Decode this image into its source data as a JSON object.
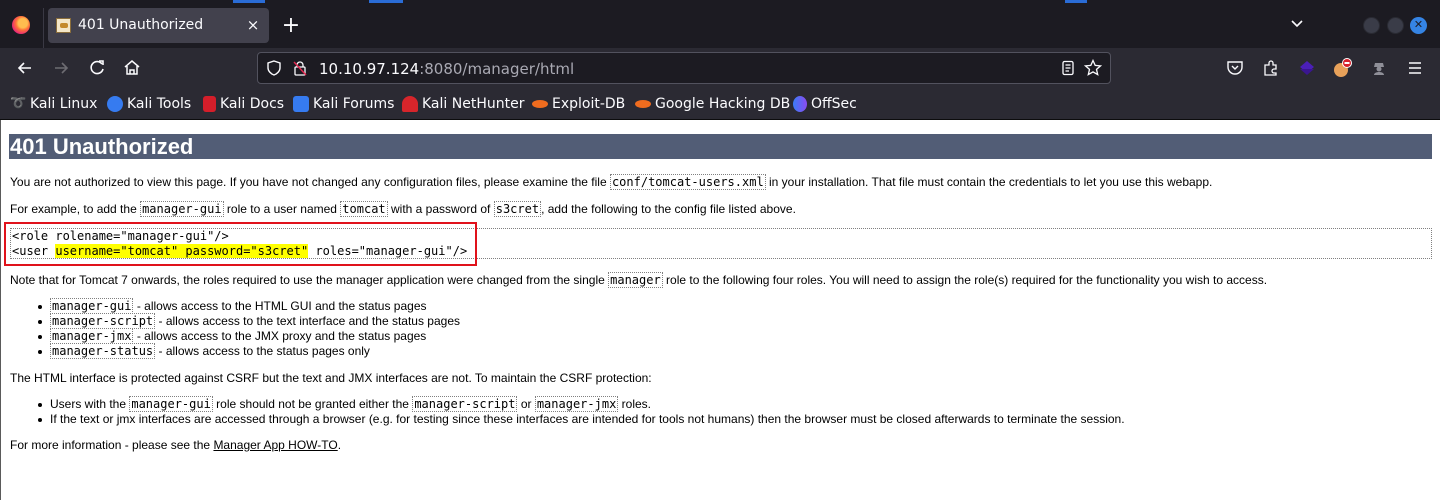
{
  "browser": {
    "tab": {
      "title": "401 Unauthorized",
      "close_label": "×"
    },
    "new_tab_label": "+",
    "url": {
      "host": "10.10.97.124",
      "rest": ":8080/manager/html"
    },
    "icons": {
      "firefox": "firefox-logo-icon",
      "back": "arrow-left-icon",
      "forward": "arrow-right-icon",
      "reload": "reload-icon",
      "home": "home-icon",
      "shield": "tracking-shield-icon",
      "insecure_lock": "insecure-lock-icon",
      "reader": "reader-view-icon",
      "bookmark_star": "star-icon",
      "pocket": "pocket-icon",
      "extensions": "puzzle-icon",
      "menu": "hamburger-menu-icon"
    }
  },
  "bookmarks": [
    {
      "label": "Kali Linux",
      "icon": "kali-dragon-icon",
      "color": "#cfd3d8"
    },
    {
      "label": "Kali Tools",
      "icon": "kali-tools-icon",
      "color": "#367bf0"
    },
    {
      "label": "Kali Docs",
      "icon": "kali-docs-icon",
      "color": "#d41e2a"
    },
    {
      "label": "Kali Forums",
      "icon": "kali-forums-icon",
      "color": "#367bf0"
    },
    {
      "label": "Kali NetHunter",
      "icon": "nethunter-icon",
      "color": "#d6252b"
    },
    {
      "label": "Exploit-DB",
      "icon": "exploit-db-icon",
      "color": "#ef6c1f"
    },
    {
      "label": "Google Hacking DB",
      "icon": "ghdb-icon",
      "color": "#ef6c1f"
    },
    {
      "label": "OffSec",
      "icon": "offsec-icon",
      "color": "#3b7cf5"
    }
  ],
  "page": {
    "heading": "401 Unauthorized",
    "p1": {
      "before": "You are not authorized to view this page. If you have not changed any configuration files, please examine the file ",
      "code": "conf/tomcat-users.xml",
      "after": " in your installation. That file must contain the credentials to let you use this webapp."
    },
    "p2": {
      "t1": "For example, to add the ",
      "c1": "manager-gui",
      "t2": " role to a user named ",
      "c2": "tomcat",
      "t3": " with a password of ",
      "c3": "s3cret",
      "t4": ", add the following to the config file listed above."
    },
    "pre": {
      "line1": "<role rolename=\"manager-gui\"/>",
      "line2_start": "<user ",
      "line2_highlight": "username=\"tomcat\" password=\"s3cret\"",
      "line2_end": " roles=\"manager-gui\"/>"
    },
    "highlight_color": "#ffff00",
    "annotation_box_color": "#e0121b",
    "p3": {
      "before": "Note that for Tomcat 7 onwards, the roles required to use the manager application were changed from the single ",
      "code": "manager",
      "after": " role to the following four roles. You will need to assign the role(s) required for the functionality you wish to access."
    },
    "roles": [
      {
        "code": "manager-gui",
        "text": " - allows access to the HTML GUI and the status pages"
      },
      {
        "code": "manager-script",
        "text": " - allows access to the text interface and the status pages"
      },
      {
        "code": "manager-jmx",
        "text": " - allows access to the JMX proxy and the status pages"
      },
      {
        "code": "manager-status",
        "text": " - allows access to the status pages only"
      }
    ],
    "p4": "The HTML interface is protected against CSRF but the text and JMX interfaces are not. To maintain the CSRF protection:",
    "csrf": {
      "item1": {
        "t1": "Users with the ",
        "c1": "manager-gui",
        "t2": " role should not be granted either the ",
        "c2": "manager-script",
        "t3": " or ",
        "c3": "manager-jmx",
        "t4": " roles."
      },
      "item2": "If the text or jmx interfaces are accessed through a browser (e.g. for testing since these interfaces are intended for tools not humans) then the browser must be closed afterwards to terminate the session."
    },
    "p5": {
      "before": "For more information - please see the ",
      "link": "Manager App HOW-TO",
      "after": "."
    },
    "heading_bg": "#525d76"
  }
}
